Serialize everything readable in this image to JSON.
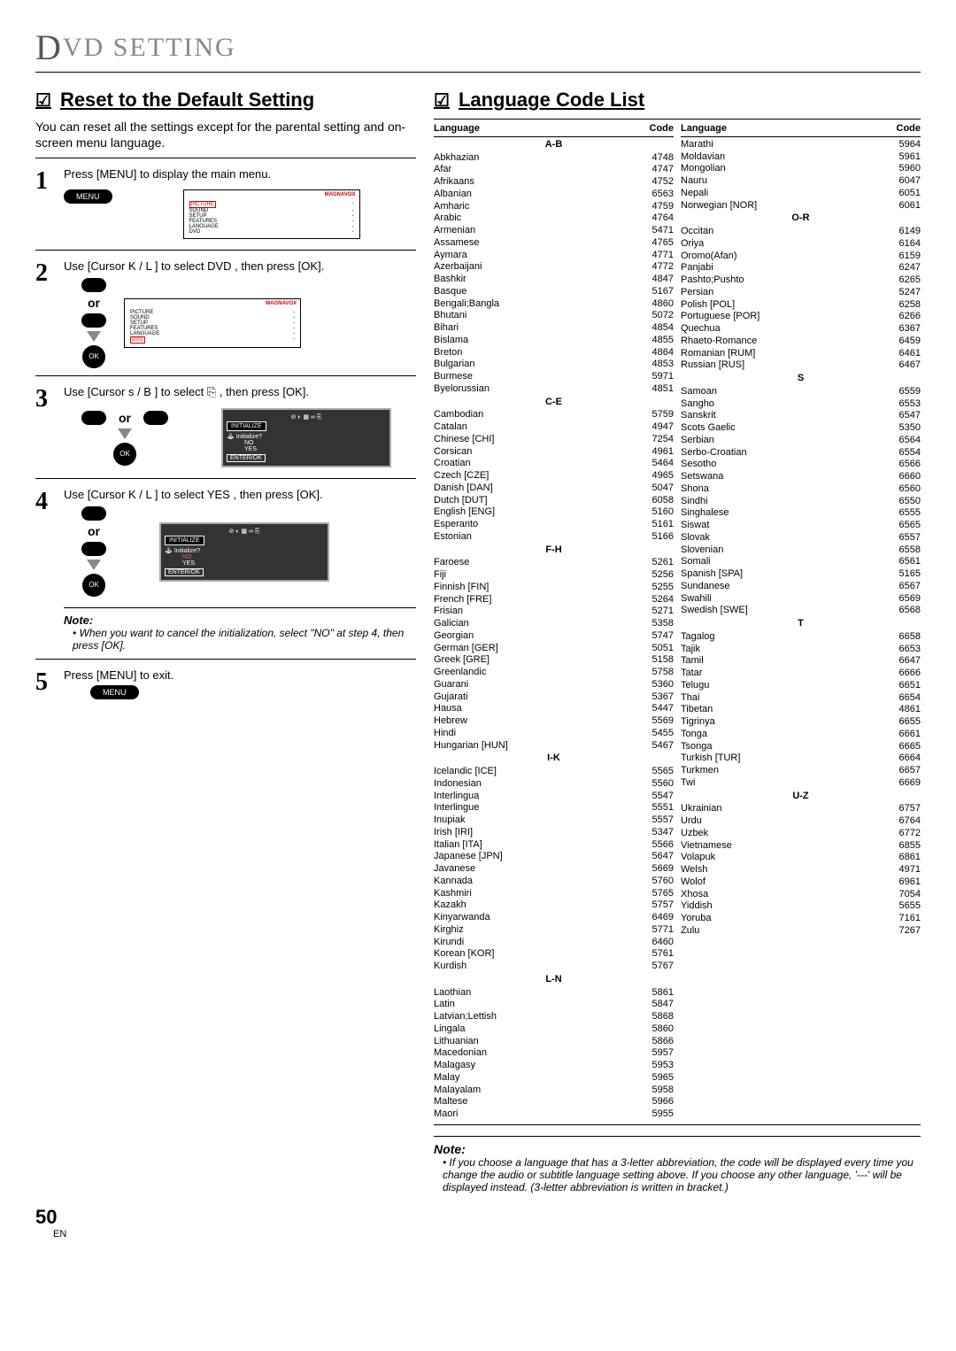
{
  "header": {
    "title_prefix": "D",
    "title_rest": "VD  SETTING"
  },
  "reset": {
    "title": "Reset to the Default Setting",
    "intro": "You can reset all the settings except for the parental setting and on-screen menu language.",
    "step1": "Press [MENU] to display the main menu.",
    "step2": "Use [Cursor K / L ] to select  DVD , then press [OK].",
    "step3": "Use [Cursor s / B ] to select  ⎘ , then press [OK].",
    "step4": "Use [Cursor K / L ] to select  YES , then press [OK].",
    "note_label": "Note:",
    "note_body": "• When you want to cancel the initialization, select \"NO\" at step 4, then press [OK].",
    "step5": "Press [MENU] to exit.",
    "menu_btn": "MENU",
    "ok": "OK",
    "or": "or",
    "screen1_items": [
      "PICTURE",
      "SOUND",
      "SETUP",
      "FEATURES",
      "LANGUAGE",
      "DVD"
    ],
    "dialog": {
      "title": "INITIALIZE",
      "q": "Initialize?",
      "no": "NO",
      "yes": "YES",
      "enter": "ENTER/OK"
    },
    "brand": "MAGNAVOX"
  },
  "langlist": {
    "title": "Language Code List",
    "col_headers": {
      "lang": "Language",
      "code": "Code"
    },
    "note_label": "Note:",
    "note_body": "• If you choose a language that has a 3-letter abbreviation, the code will be displayed every time you change the audio or subtitle language setting above. If you choose any other language, '---' will be displayed instead. (3-letter abbreviation is written in bracket.)",
    "col1": [
      {
        "g": "A-B"
      },
      {
        "n": "Abkhazian",
        "c": "4748"
      },
      {
        "n": "Afar",
        "c": "4747"
      },
      {
        "n": "Afrikaans",
        "c": "4752"
      },
      {
        "n": "Albanian",
        "c": "6563"
      },
      {
        "n": "Amharic",
        "c": "4759"
      },
      {
        "n": "Arabic",
        "c": "4764"
      },
      {
        "n": "Armenian",
        "c": "5471"
      },
      {
        "n": "Assamese",
        "c": "4765"
      },
      {
        "n": "Aymara",
        "c": "4771"
      },
      {
        "n": "Azerbaijani",
        "c": "4772"
      },
      {
        "n": "Bashkir",
        "c": "4847"
      },
      {
        "n": "Basque",
        "c": "5167"
      },
      {
        "n": "Bengali;Bangla",
        "c": "4860"
      },
      {
        "n": "Bhutani",
        "c": "5072"
      },
      {
        "n": "Bihari",
        "c": "4854"
      },
      {
        "n": "Bislama",
        "c": "4855"
      },
      {
        "n": "Breton",
        "c": "4864"
      },
      {
        "n": "Bulgarian",
        "c": "4853"
      },
      {
        "n": "Burmese",
        "c": "5971"
      },
      {
        "n": "Byelorussian",
        "c": "4851"
      },
      {
        "g": "C-E"
      },
      {
        "n": "Cambodian",
        "c": "5759"
      },
      {
        "n": "Catalan",
        "c": "4947"
      },
      {
        "n": "Chinese [CHI]",
        "c": "7254"
      },
      {
        "n": "Corsican",
        "c": "4961"
      },
      {
        "n": "Croatian",
        "c": "5464"
      },
      {
        "n": "Czech [CZE]",
        "c": "4965"
      },
      {
        "n": "Danish [DAN]",
        "c": "5047"
      },
      {
        "n": "Dutch [DUT]",
        "c": "6058"
      },
      {
        "n": "English [ENG]",
        "c": "5160"
      },
      {
        "n": "Esperanto",
        "c": "5161"
      },
      {
        "n": "Estonian",
        "c": "5166"
      },
      {
        "g": "F-H"
      },
      {
        "n": "Faroese",
        "c": "5261"
      },
      {
        "n": "Fiji",
        "c": "5256"
      },
      {
        "n": "Finnish [FIN]",
        "c": "5255"
      },
      {
        "n": "French [FRE]",
        "c": "5264"
      },
      {
        "n": "Frisian",
        "c": "5271"
      },
      {
        "n": "Galician",
        "c": "5358"
      },
      {
        "n": "Georgian",
        "c": "5747"
      },
      {
        "n": "German [GER]",
        "c": "5051"
      },
      {
        "n": "Greek [GRE]",
        "c": "5158"
      },
      {
        "n": "Greenlandic",
        "c": "5758"
      },
      {
        "n": "Guarani",
        "c": "5360"
      },
      {
        "n": "Gujarati",
        "c": "5367"
      },
      {
        "n": "Hausa",
        "c": "5447"
      },
      {
        "n": "Hebrew",
        "c": "5569"
      },
      {
        "n": "Hindi",
        "c": "5455"
      },
      {
        "n": "Hungarian [HUN]",
        "c": "5467"
      },
      {
        "g": "I-K"
      },
      {
        "n": "Icelandic [ICE]",
        "c": "5565"
      },
      {
        "n": "Indonesian",
        "c": "5560"
      },
      {
        "n": "Interlingua",
        "c": "5547"
      },
      {
        "n": "Interlingue",
        "c": "5551"
      },
      {
        "n": "Inupiak",
        "c": "5557"
      },
      {
        "n": "Irish [IRI]",
        "c": "5347"
      },
      {
        "n": "Italian [ITA]",
        "c": "5566"
      },
      {
        "n": "Japanese [JPN]",
        "c": "5647"
      },
      {
        "n": "Javanese",
        "c": "5669"
      },
      {
        "n": "Kannada",
        "c": "5760"
      },
      {
        "n": "Kashmiri",
        "c": "5765"
      },
      {
        "n": "Kazakh",
        "c": "5757"
      },
      {
        "n": "Kinyarwanda",
        "c": "6469"
      },
      {
        "n": "Kirghiz",
        "c": "5771"
      },
      {
        "n": "Kirundi",
        "c": "6460"
      },
      {
        "n": "Korean [KOR]",
        "c": "5761"
      },
      {
        "n": "Kurdish",
        "c": "5767"
      },
      {
        "g": "L-N"
      },
      {
        "n": "Laothian",
        "c": "5861"
      },
      {
        "n": "Latin",
        "c": "5847"
      },
      {
        "n": "Latvian;Lettish",
        "c": "5868"
      },
      {
        "n": "Lingala",
        "c": "5860"
      },
      {
        "n": "Lithuanian",
        "c": "5866"
      },
      {
        "n": "Macedonian",
        "c": "5957"
      },
      {
        "n": "Malagasy",
        "c": "5953"
      },
      {
        "n": "Malay",
        "c": "5965"
      },
      {
        "n": "Malayalam",
        "c": "5958"
      },
      {
        "n": "Maltese",
        "c": "5966"
      },
      {
        "n": "Maori",
        "c": "5955"
      }
    ],
    "col2": [
      {
        "n": "Marathi",
        "c": "5964"
      },
      {
        "n": "Moldavian",
        "c": "5961"
      },
      {
        "n": "Mongolian",
        "c": "5960"
      },
      {
        "n": "Nauru",
        "c": "6047"
      },
      {
        "n": "Nepali",
        "c": "6051"
      },
      {
        "n": "Norwegian [NOR]",
        "c": "6061"
      },
      {
        "g": "O-R"
      },
      {
        "n": "Occitan",
        "c": "6149"
      },
      {
        "n": "Oriya",
        "c": "6164"
      },
      {
        "n": "Oromo(Afan)",
        "c": "6159"
      },
      {
        "n": "Panjabi",
        "c": "6247"
      },
      {
        "n": "Pashto;Pushto",
        "c": "6265"
      },
      {
        "n": "Persian",
        "c": "5247"
      },
      {
        "n": "Polish [POL]",
        "c": "6258"
      },
      {
        "n": "Portuguese [POR]",
        "c": "6266"
      },
      {
        "n": "Quechua",
        "c": "6367"
      },
      {
        "n": "Rhaeto-Romance",
        "c": "6459"
      },
      {
        "n": "Romanian [RUM]",
        "c": "6461"
      },
      {
        "n": "Russian [RUS]",
        "c": "6467"
      },
      {
        "g": "S"
      },
      {
        "n": "Samoan",
        "c": "6559"
      },
      {
        "n": "Sangho",
        "c": "6553"
      },
      {
        "n": "Sanskrit",
        "c": "6547"
      },
      {
        "n": "Scots Gaelic",
        "c": "5350"
      },
      {
        "n": "Serbian",
        "c": "6564"
      },
      {
        "n": "Serbo-Croatian",
        "c": "6554"
      },
      {
        "n": "Sesotho",
        "c": "6566"
      },
      {
        "n": "Setswana",
        "c": "6660"
      },
      {
        "n": "Shona",
        "c": "6560"
      },
      {
        "n": "Sindhi",
        "c": "6550"
      },
      {
        "n": "Singhalese",
        "c": "6555"
      },
      {
        "n": "Siswat",
        "c": "6565"
      },
      {
        "n": "Slovak",
        "c": "6557"
      },
      {
        "n": "Slovenian",
        "c": "6558"
      },
      {
        "n": "Somali",
        "c": "6561"
      },
      {
        "n": "Spanish [SPA]",
        "c": "5165"
      },
      {
        "n": "Sundanese",
        "c": "6567"
      },
      {
        "n": "Swahili",
        "c": "6569"
      },
      {
        "n": "Swedish [SWE]",
        "c": "6568"
      },
      {
        "g": "T"
      },
      {
        "n": "Tagalog",
        "c": "6658"
      },
      {
        "n": "Tajik",
        "c": "6653"
      },
      {
        "n": "Tamil",
        "c": "6647"
      },
      {
        "n": "Tatar",
        "c": "6666"
      },
      {
        "n": "Telugu",
        "c": "6651"
      },
      {
        "n": "Thai",
        "c": "6654"
      },
      {
        "n": "Tibetan",
        "c": "4861"
      },
      {
        "n": "Tigrinya",
        "c": "6655"
      },
      {
        "n": "Tonga",
        "c": "6661"
      },
      {
        "n": "Tsonga",
        "c": "6665"
      },
      {
        "n": "Turkish [TUR]",
        "c": "6664"
      },
      {
        "n": "Turkmen",
        "c": "6657"
      },
      {
        "n": "Twi",
        "c": "6669"
      },
      {
        "g": "U-Z"
      },
      {
        "n": "Ukrainian",
        "c": "6757"
      },
      {
        "n": "Urdu",
        "c": "6764"
      },
      {
        "n": "Uzbek",
        "c": "6772"
      },
      {
        "n": "Vietnamese",
        "c": "6855"
      },
      {
        "n": "Volapuk",
        "c": "6861"
      },
      {
        "n": "Welsh",
        "c": "4971"
      },
      {
        "n": "Wolof",
        "c": "6961"
      },
      {
        "n": "Xhosa",
        "c": "7054"
      },
      {
        "n": "Yiddish",
        "c": "5655"
      },
      {
        "n": "Yoruba",
        "c": "7161"
      },
      {
        "n": "Zulu",
        "c": "7267"
      }
    ]
  },
  "page": {
    "num": "50",
    "en": "EN"
  }
}
